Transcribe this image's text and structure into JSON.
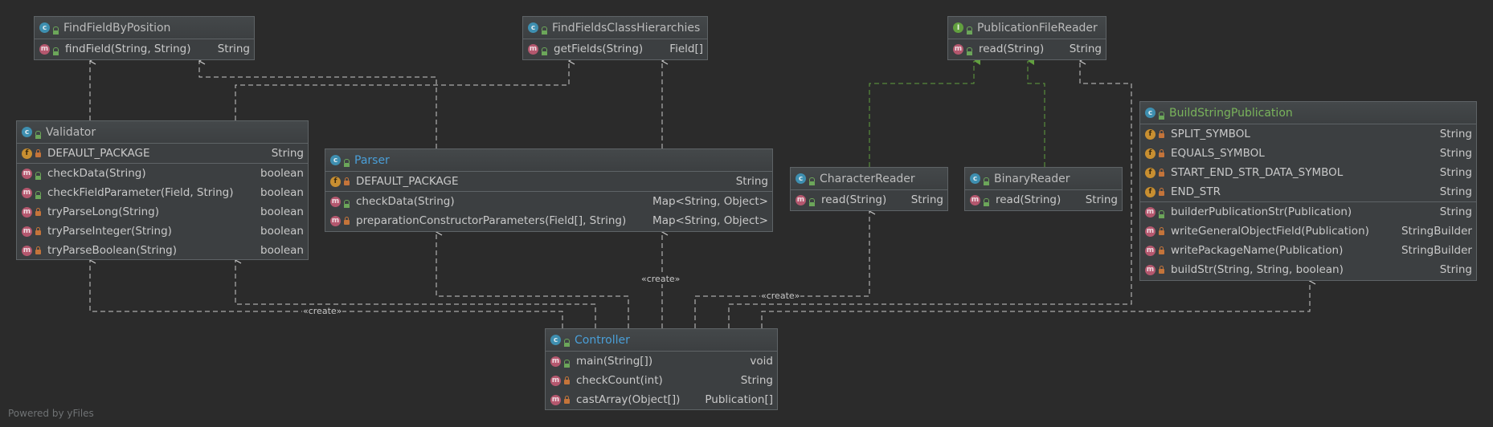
{
  "classes": {
    "findFieldByPosition": {
      "name": "FindFieldByPosition",
      "kind": "C",
      "members": [
        {
          "kind": "m",
          "vis": "pub",
          "name": "findField(String, String)",
          "type": "String"
        }
      ]
    },
    "findFieldsClassHierarchies": {
      "name": "FindFieldsClassHierarchies",
      "kind": "C",
      "members": [
        {
          "kind": "m",
          "vis": "pub",
          "name": "getFields(String)",
          "type": "Field[]"
        }
      ]
    },
    "publicationFileReader": {
      "name": "PublicationFileReader",
      "kind": "I",
      "members": [
        {
          "kind": "m",
          "vis": "pub",
          "name": "read(String)",
          "type": "String"
        }
      ]
    },
    "validator": {
      "name": "Validator",
      "kind": "C",
      "fields": [
        {
          "kind": "f",
          "vis": "priv",
          "name": "DEFAULT_PACKAGE",
          "type": "String"
        }
      ],
      "members": [
        {
          "kind": "m",
          "vis": "pub",
          "name": "checkData(String)",
          "type": "boolean"
        },
        {
          "kind": "m",
          "vis": "pub",
          "name": "checkFieldParameter(Field, String)",
          "type": "boolean"
        },
        {
          "kind": "m",
          "vis": "priv",
          "name": "tryParseLong(String)",
          "type": "boolean"
        },
        {
          "kind": "m",
          "vis": "priv",
          "name": "tryParseInteger(String)",
          "type": "boolean"
        },
        {
          "kind": "m",
          "vis": "priv",
          "name": "tryParseBoolean(String)",
          "type": "boolean"
        }
      ]
    },
    "parser": {
      "name": "Parser",
      "kind": "C",
      "fields": [
        {
          "kind": "f",
          "vis": "priv",
          "name": "DEFAULT_PACKAGE",
          "type": "String"
        }
      ],
      "members": [
        {
          "kind": "m",
          "vis": "pub",
          "name": "checkData(String)",
          "type": "Map<String, Object>"
        },
        {
          "kind": "m",
          "vis": "priv",
          "name": "preparationConstructorParameters(Field[], String)",
          "type": "Map<String, Object>"
        }
      ]
    },
    "characterReader": {
      "name": "CharacterReader",
      "kind": "C",
      "members": [
        {
          "kind": "m",
          "vis": "pub",
          "name": "read(String)",
          "type": "String"
        }
      ]
    },
    "binaryReader": {
      "name": "BinaryReader",
      "kind": "C",
      "members": [
        {
          "kind": "m",
          "vis": "pub",
          "name": "read(String)",
          "type": "String"
        }
      ]
    },
    "buildStringPublication": {
      "name": "BuildStringPublication",
      "kind": "C",
      "fields": [
        {
          "kind": "f",
          "vis": "priv",
          "name": "SPLIT_SYMBOL",
          "type": "String"
        },
        {
          "kind": "f",
          "vis": "priv",
          "name": "EQUALS_SYMBOL",
          "type": "String"
        },
        {
          "kind": "f",
          "vis": "priv",
          "name": "START_END_STR_DATA_SYMBOL",
          "type": "String"
        },
        {
          "kind": "f",
          "vis": "priv",
          "name": "END_STR",
          "type": "String"
        }
      ],
      "members": [
        {
          "kind": "m",
          "vis": "pub",
          "name": "builderPublicationStr(Publication)",
          "type": "String"
        },
        {
          "kind": "m",
          "vis": "priv",
          "name": "writeGeneralObjectField(Publication)",
          "type": "StringBuilder"
        },
        {
          "kind": "m",
          "vis": "priv",
          "name": "writePackageName(Publication)",
          "type": "StringBuilder"
        },
        {
          "kind": "m",
          "vis": "priv",
          "name": "buildStr(String, String, boolean)",
          "type": "String"
        }
      ]
    },
    "controller": {
      "name": "Controller",
      "kind": "C",
      "members": [
        {
          "kind": "m",
          "vis": "pub",
          "name": "main(String[])",
          "type": "void"
        },
        {
          "kind": "m",
          "vis": "priv",
          "name": "checkCount(int)",
          "type": "String"
        },
        {
          "kind": "m",
          "vis": "priv",
          "name": "castArray(Object[])",
          "type": "Publication[]"
        }
      ]
    }
  },
  "labels": {
    "create_1": "«create»",
    "create_2": "«create»",
    "create_3": "«create»"
  },
  "footer": "Powered by yFiles",
  "colors": {
    "background": "#2b2b2b",
    "node": "#3c3f41",
    "dependency": "#c8c8c8",
    "realization": "#62a03f"
  }
}
